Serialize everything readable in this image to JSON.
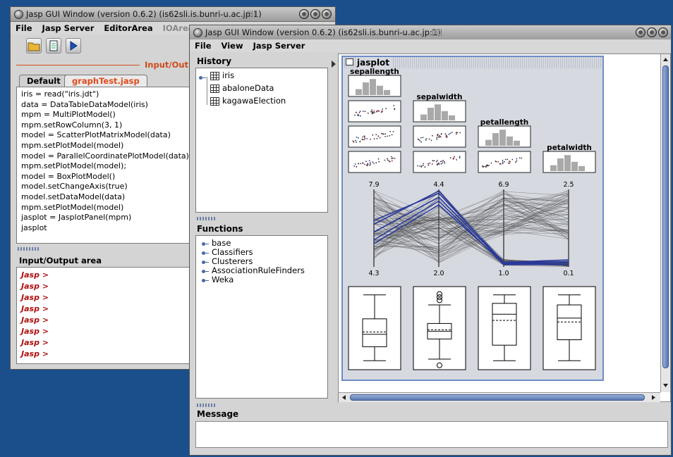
{
  "desktop": {
    "background": "#1a4f8c"
  },
  "left_window": {
    "title": "Jasp GUI Window (version 0.6.2) (is62sli.is.bunri-u.ac.jp:1)",
    "menu": [
      "File",
      "Jasp Server",
      "EditorArea",
      "IOArea"
    ],
    "toolbar": [
      "open-folder-icon",
      "document-icon",
      "run-icon"
    ],
    "section_title": "Input/Output",
    "tabs": [
      {
        "label": "Default",
        "active": false
      },
      {
        "label": "graphTest.jasp",
        "active": true,
        "color": "#e04a1a"
      }
    ],
    "code": [
      "iris = read(\"iris.jdt\")",
      "data = DataTableDataModel(iris)",
      "mpm = MultiPlotModel()",
      "mpm.setRowColumn(3, 1)",
      "model = ScatterPlotMatrixModel(data)",
      "mpm.setPlotModel(model)",
      "model = ParallelCoordinatePlotModel(data)",
      "mpm.setPlotModel(model);",
      "model = BoxPlotModel()",
      "model.setChangeAxis(true)",
      "model.setDataModel(data)",
      "mpm.setPlotModel(model)",
      "jasplot = JasplotPanel(mpm)",
      "jasplot"
    ],
    "io_area_title": "Input/Output area",
    "prompts": [
      "Jasp >",
      "Jasp >",
      "Jasp >",
      "Jasp >",
      "Jasp >",
      "Jasp >",
      "Jasp >",
      "Jasp >"
    ]
  },
  "right_window": {
    "title": "Jasp GUI Window (version 0.6.2) (is62sli.is.bunri-u.ac.jp:1)",
    "menu": [
      "File",
      "View",
      "Jasp Server"
    ],
    "history_title": "History",
    "history": [
      "iris",
      "abaloneData",
      "kagawaElection"
    ],
    "functions_title": "Functions",
    "functions": [
      "base",
      "Classifiers",
      "Clusterers",
      "AssociationRuleFinders",
      "Weka"
    ],
    "jasplot_title": "jasplot",
    "message_title": "Message",
    "message_text": ""
  },
  "chart_data": [
    {
      "type": "scatter",
      "subtype": "scatter-plot-matrix-with-histograms",
      "variables": [
        "sepallength",
        "sepalwidth",
        "petallength",
        "petalwidth"
      ],
      "diagonal": "histogram",
      "layout": "lower-triangle"
    },
    {
      "type": "line",
      "subtype": "parallel-coordinates",
      "axes": [
        "sepallength",
        "sepalwidth",
        "petallength",
        "petalwidth"
      ],
      "axis_max_labels": [
        "7.9",
        "4.4",
        "6.9",
        "2.5"
      ],
      "axis_min_labels": [
        "4.3",
        "2.0",
        "1.0",
        "0.1"
      ],
      "highlighted_color": "#2a3a9a",
      "line_color": "#555555"
    },
    {
      "type": "box",
      "groups": 4,
      "box_color": "#000000"
    }
  ]
}
